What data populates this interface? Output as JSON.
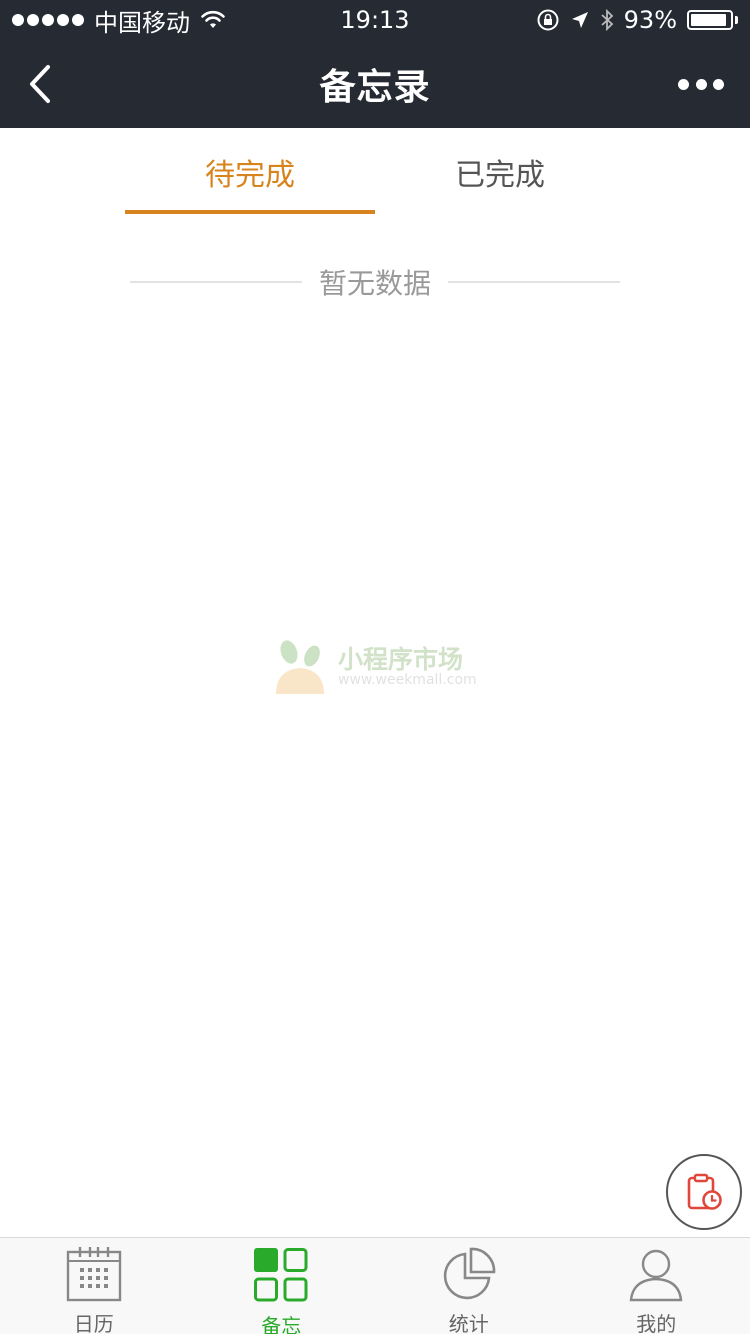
{
  "status_bar": {
    "carrier": "中国移动",
    "time": "19:13",
    "battery": "93%",
    "battery_level": 0.93
  },
  "nav_bar": {
    "title": "备忘录"
  },
  "tabs": [
    {
      "label": "待完成",
      "active": true
    },
    {
      "label": "已完成",
      "active": false
    }
  ],
  "empty_state": {
    "text": "暂无数据"
  },
  "watermark": {
    "title": "小程序市场",
    "url": "www.weekmall.com"
  },
  "tab_bar": {
    "items": [
      {
        "label": "日历",
        "icon": "calendar-icon",
        "active": false
      },
      {
        "label": "备忘",
        "icon": "grid-icon",
        "active": true
      },
      {
        "label": "统计",
        "icon": "pie-chart-icon",
        "active": false
      },
      {
        "label": "我的",
        "icon": "user-icon",
        "active": false
      }
    ]
  },
  "colors": {
    "header_bg": "#262a33",
    "accent": "#d8841e",
    "active_green": "#2aaa2a",
    "fab_icon": "#e0463a"
  }
}
